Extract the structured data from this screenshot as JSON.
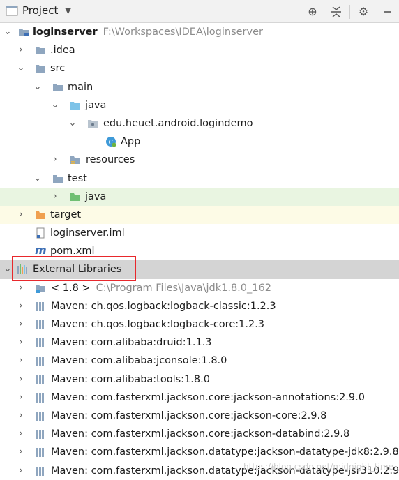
{
  "toolbar": {
    "title": "Project",
    "icons": [
      "project-folder-icon",
      "crosshair-icon",
      "collapse-icon",
      "gear-icon",
      "minimize-icon"
    ]
  },
  "tree": {
    "root": {
      "name": "loginserver",
      "path": "F:\\Workspaces\\IDEA\\loginserver"
    },
    "idea": ".idea",
    "src": "src",
    "main": "main",
    "main_java": "java",
    "package": "edu.heuet.android.logindemo",
    "app": "App",
    "resources": "resources",
    "test": "test",
    "test_java": "java",
    "target": "target",
    "iml": "loginserver.iml",
    "pom": "pom.xml",
    "external": "External Libraries",
    "jdk": {
      "name": "< 1.8 >",
      "path": "C:\\Program Files\\Java\\jdk1.8.0_162"
    },
    "libs": [
      "Maven: ch.qos.logback:logback-classic:1.2.3",
      "Maven: ch.qos.logback:logback-core:1.2.3",
      "Maven: com.alibaba:druid:1.1.3",
      "Maven: com.alibaba:jconsole:1.8.0",
      "Maven: com.alibaba:tools:1.8.0",
      "Maven: com.fasterxml.jackson.core:jackson-annotations:2.9.0",
      "Maven: com.fasterxml.jackson.core:jackson-core:2.9.8",
      "Maven: com.fasterxml.jackson.core:jackson-databind:2.9.8",
      "Maven: com.fasterxml.jackson.datatype:jackson-datatype-jdk8:2.9.8",
      "Maven: com.fasterxml.jackson.datatype:jackson-datatype-jsr310:2.9"
    ]
  },
  "watermark": "https://blog.csdn.net/midnight_time",
  "colors": {
    "folder": "#8fa6bf",
    "source_folder": "#7ec3e8",
    "test_folder": "#6fbf73",
    "excluded_folder": "#f0a050",
    "highlight": "#e8282c"
  }
}
